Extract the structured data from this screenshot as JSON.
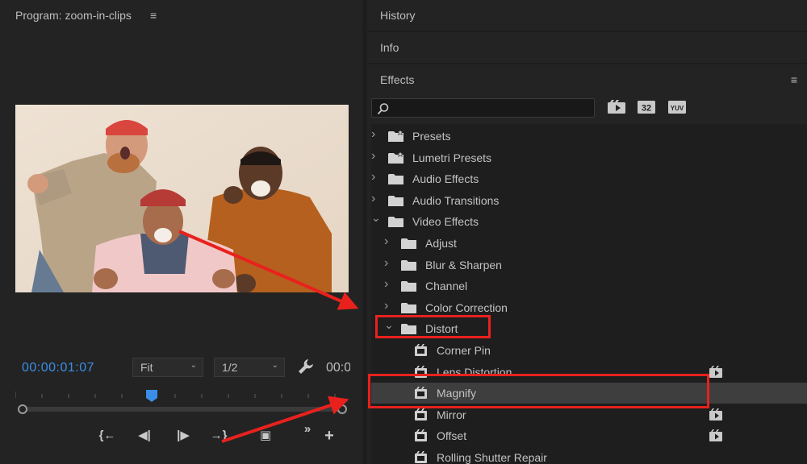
{
  "program": {
    "title": "Program: zoom-in-clips",
    "menu_glyph": "≡",
    "timecode": "00:00:01:07",
    "fit": "Fit",
    "resolution": "1/2",
    "timecode_end": "00:0",
    "caret": "⌄"
  },
  "transport": [
    {
      "name": "go-to-in-button",
      "glyph": "{←"
    },
    {
      "name": "step-back-button",
      "glyph": "◀|"
    },
    {
      "name": "step-forward-button",
      "glyph": "|▶"
    },
    {
      "name": "go-to-out-button",
      "glyph": "→}"
    },
    {
      "name": "export-frame-button",
      "glyph": "▣"
    },
    {
      "name": "more-controls-button",
      "glyph": "»"
    },
    {
      "name": "add-button",
      "glyph": "+"
    }
  ],
  "panels": {
    "history": "History",
    "info": "Info",
    "effects": "Effects",
    "effects_menu": "≡"
  },
  "filters": [
    "accelerated-effects-icon",
    "32-bit-icon",
    "yuv-icon"
  ],
  "filter_labels": {
    "b32": "32",
    "yuv": "YUV"
  },
  "effects_tree": [
    {
      "label": "Presets",
      "type": "bin-star",
      "expanded": false,
      "level": 0,
      "accel": false
    },
    {
      "label": "Lumetri Presets",
      "type": "bin-star",
      "expanded": false,
      "level": 0,
      "accel": false
    },
    {
      "label": "Audio Effects",
      "type": "bin",
      "expanded": false,
      "level": 0,
      "accel": false
    },
    {
      "label": "Audio Transitions",
      "type": "bin",
      "expanded": false,
      "level": 0,
      "accel": false
    },
    {
      "label": "Video Effects",
      "type": "bin",
      "expanded": true,
      "level": 0,
      "accel": false
    },
    {
      "label": "Adjust",
      "type": "bin",
      "expanded": false,
      "level": 1,
      "accel": false
    },
    {
      "label": "Blur & Sharpen",
      "type": "bin",
      "expanded": false,
      "level": 1,
      "accel": false
    },
    {
      "label": "Channel",
      "type": "bin",
      "expanded": false,
      "level": 1,
      "accel": false
    },
    {
      "label": "Color Correction",
      "type": "bin",
      "expanded": false,
      "level": 1,
      "accel": false
    },
    {
      "label": "Distort",
      "type": "bin",
      "expanded": true,
      "level": 1,
      "accel": false
    },
    {
      "label": "Corner Pin",
      "type": "effect",
      "level": 2,
      "accel": false
    },
    {
      "label": "Lens Distortion",
      "type": "effect",
      "level": 2,
      "accel": true
    },
    {
      "label": "Magnify",
      "type": "effect",
      "level": 2,
      "accel": false,
      "selected": true
    },
    {
      "label": "Mirror",
      "type": "effect",
      "level": 2,
      "accel": true
    },
    {
      "label": "Offset",
      "type": "effect",
      "level": 2,
      "accel": true
    },
    {
      "label": "Rolling Shutter Repair",
      "type": "effect",
      "level": 2,
      "accel": false
    }
  ],
  "colors": {
    "accent": "#3a8ee6",
    "annotation": "#e8211d",
    "panel": "#232323",
    "tree_bg": "#1e1e1e",
    "selected_row": "#3e3e3e"
  }
}
